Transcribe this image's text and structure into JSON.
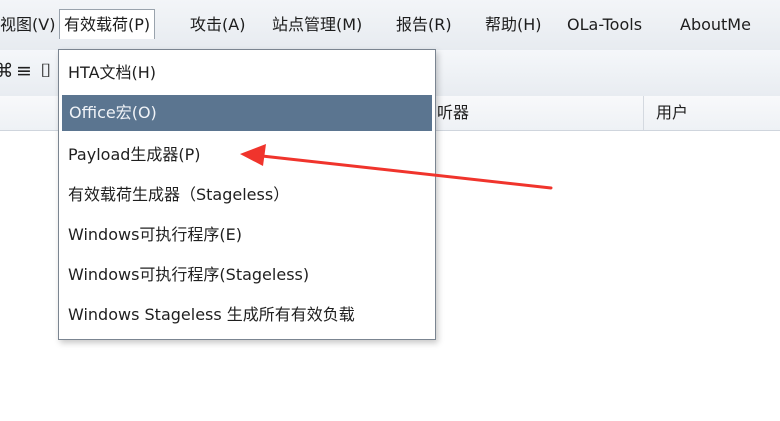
{
  "menubar": {
    "items": [
      "视图(V)",
      "有效载荷(P)",
      "攻击(A)",
      "站点管理(M)",
      "报告(R)",
      "帮助(H)",
      "OLa-Tools",
      "AboutMe"
    ]
  },
  "toolbar": {
    "icons": [
      "unknown-icon",
      "list-icon",
      "bracket-icon"
    ]
  },
  "table": {
    "headers": [
      "听器",
      "用户"
    ]
  },
  "dropdown": {
    "items": [
      "HTA文档(H)",
      "Office宏(O)",
      "Payload生成器(P)",
      "有效载荷生成器（Stageless）",
      "Windows可执行程序(E)",
      "Windows可执行程序(Stageless)",
      "Windows Stageless 生成所有有效负载"
    ],
    "highlighted_index": 1
  },
  "colors": {
    "highlight": "#5b7590",
    "arrow": "#f0342c"
  }
}
